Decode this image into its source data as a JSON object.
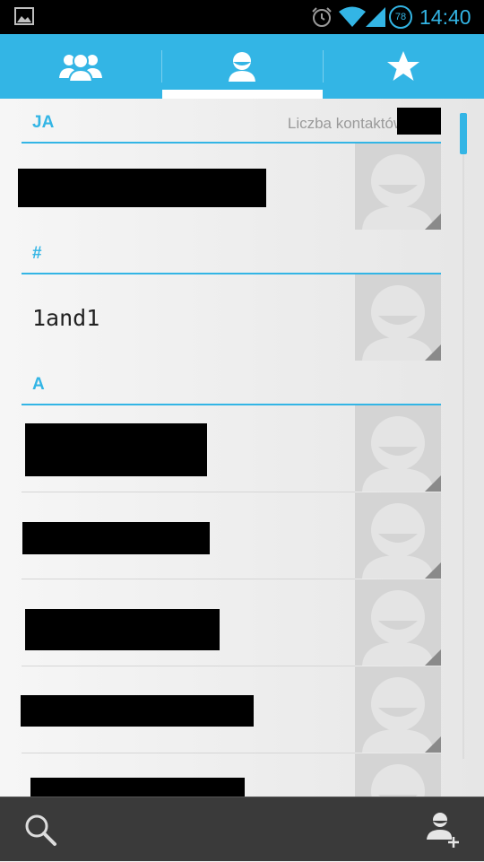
{
  "status_bar": {
    "time": "14:40",
    "battery_level": "78",
    "icons": [
      "image-notification-icon",
      "alarm-icon",
      "wifi-icon",
      "signal-icon",
      "battery-icon"
    ]
  },
  "tabs": [
    {
      "name": "groups",
      "icon": "group-icon",
      "selected": false
    },
    {
      "name": "contacts",
      "icon": "person-icon",
      "selected": true
    },
    {
      "name": "favorites",
      "icon": "star-icon",
      "selected": false
    }
  ],
  "sections": {
    "me": {
      "letter": "JA",
      "count_label": "Liczba kontaktów:"
    },
    "hash": {
      "letter": "#"
    },
    "a": {
      "letter": "A"
    }
  },
  "contacts": [
    {
      "name": "1and1"
    }
  ],
  "bottom_bar": {
    "left_icon": "search-icon",
    "right_icon": "add-contact-icon"
  },
  "colors": {
    "accent": "#33b5e5",
    "status_bar": "#000000",
    "bottom_bar": "#3a3a3a",
    "avatar_bg": "#d4d4d4"
  }
}
